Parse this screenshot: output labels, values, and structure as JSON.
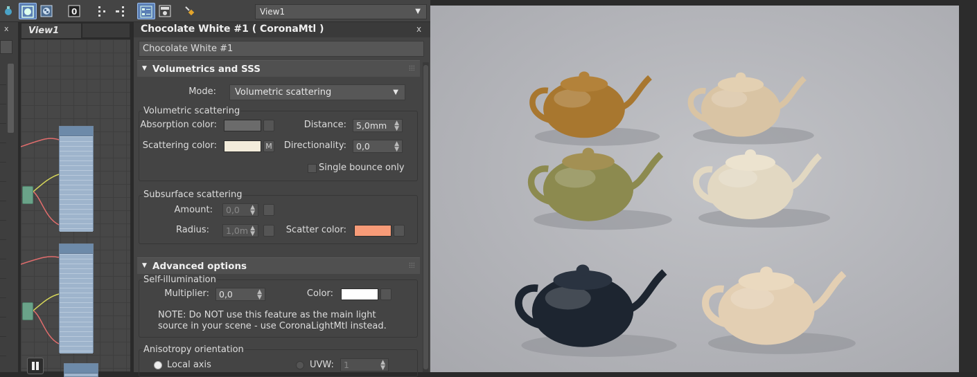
{
  "toolbar": {
    "view_select": "View1"
  },
  "left": {
    "close": "x"
  },
  "view_tab": {
    "label": "View1"
  },
  "material": {
    "title": "Chocolate White #1  ( CoronaMtl )",
    "close": "x",
    "name": "Chocolate White #1"
  },
  "volumetrics": {
    "header": "Volumetrics and SSS",
    "mode_label": "Mode:",
    "mode_value": "Volumetric scattering",
    "vs_group": "Volumetric scattering",
    "absorption_label": "Absorption color:",
    "absorption_color": "#6b6b6b",
    "distance_label": "Distance:",
    "distance_value": "5,0mm",
    "scattering_label": "Scattering color:",
    "scattering_color": "#f3ecdb",
    "scattering_map": "M",
    "directionality_label": "Directionality:",
    "directionality_value": "0,0",
    "single_bounce_label": "Single bounce only",
    "ss_group": "Subsurface scattering",
    "amount_label": "Amount:",
    "amount_value": "0,0",
    "radius_label": "Radius:",
    "radius_value": "1,0m",
    "scatter_color_label": "Scatter color:",
    "scatter_color": "#f79b78"
  },
  "advanced": {
    "header": "Advanced options",
    "self_illum_group": "Self-illumination",
    "multiplier_label": "Multiplier:",
    "multiplier_value": "0,0",
    "color_label": "Color:",
    "color_value": "#ffffff",
    "note": "NOTE: Do NOT use this feature as the main light source in your scene - use CoronaLightMtl instead.",
    "aniso_group": "Anisotropy orientation",
    "local_axis_label": "Local axis",
    "uvw_label": "UVW:",
    "uvw_value": "1"
  },
  "render": {
    "teapots": [
      {
        "body": "#a8772f",
        "lid": "#b3823a"
      },
      {
        "body": "#d9c4a4",
        "lid": "#e3d0b2"
      },
      {
        "body": "#8c8a4f",
        "lid": "#a39053"
      },
      {
        "body": "#e2d8c2",
        "lid": "#ece3cf"
      },
      {
        "body": "#1d2530",
        "lid": "#2a3340"
      },
      {
        "body": "#e3cfb3",
        "lid": "#ead9bf"
      }
    ]
  }
}
